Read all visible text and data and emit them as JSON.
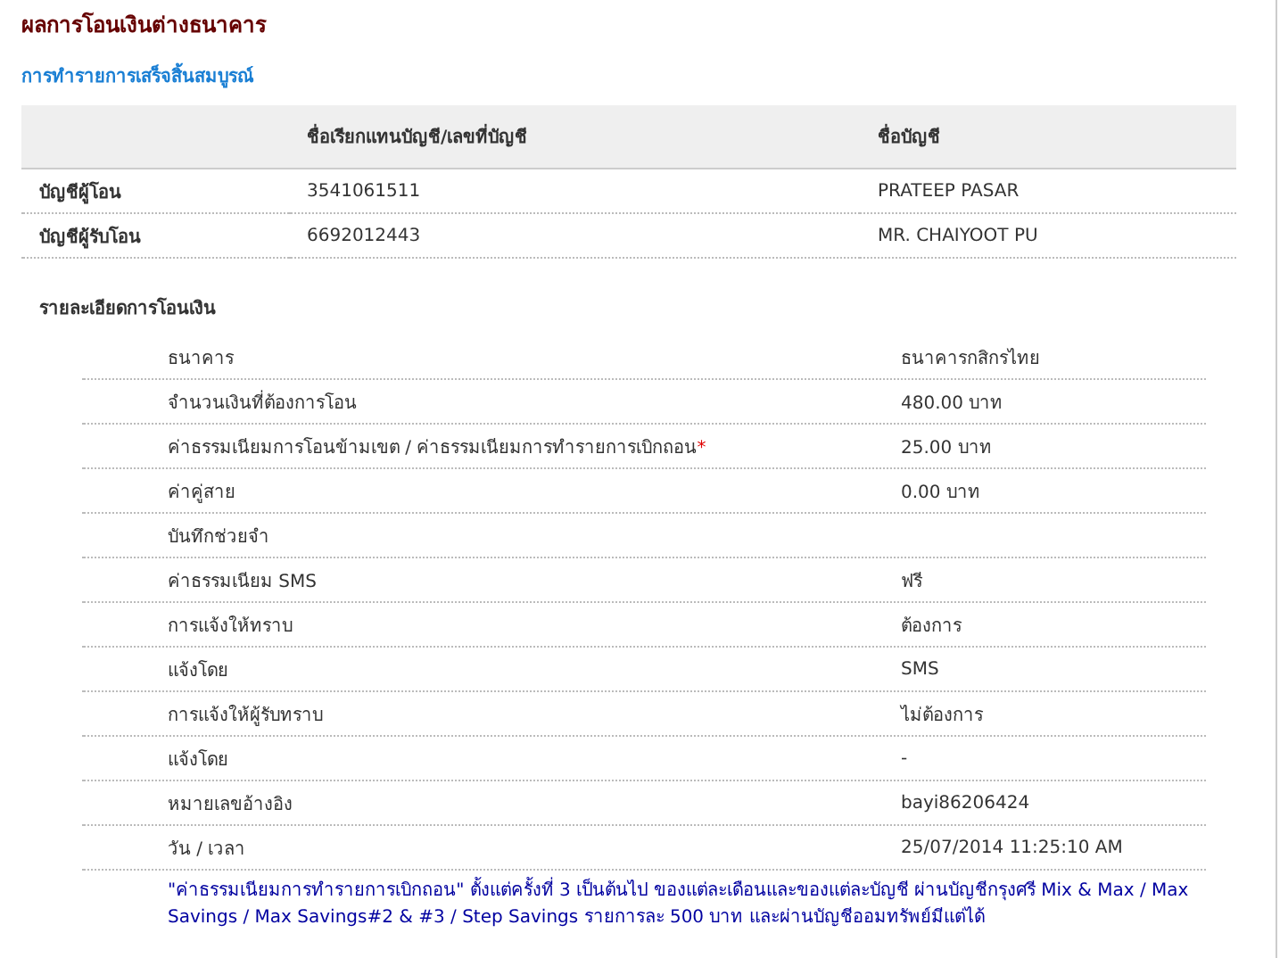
{
  "title": "ผลการโอนเงินต่างธนาคาร",
  "status": "การทำรายการเสร็จสิ้นสมบูรณ์",
  "accounts_table": {
    "columns": [
      "",
      "ชื่อเรียกแทนบัญชี/เลขที่บัญชี",
      "ชื่อบัญชี"
    ],
    "rows": [
      [
        "บัญชีผู้โอน",
        "3541061511",
        "PRATEEP PASAR"
      ],
      [
        "บัญชีผู้รับโอน",
        "6692012443",
        "MR. CHAIYOOT PU"
      ]
    ]
  },
  "details": {
    "heading": "รายละเอียดการโอนเงิน",
    "rows": [
      {
        "label": "ธนาคาร",
        "value": "ธนาคารกสิกรไทย"
      },
      {
        "label": "จำนวนเงินที่ต้องการโอน",
        "value": "480.00 บาท"
      },
      {
        "label": "ค่าธรรมเนียมการโอนข้ามเขต / ค่าธรรมเนียมการทำรายการเบิกถอน",
        "mark": "*",
        "value": "25.00 บาท"
      },
      {
        "label": "ค่าคู่สาย",
        "value": "0.00 บาท"
      },
      {
        "label": "บันทึกช่วยจำ"
      },
      {
        "label": "ค่าธรรมเนียม SMS",
        "value": "ฟรี"
      },
      {
        "label": "การแจ้งให้ทราบ",
        "value": "ต้องการ"
      },
      {
        "label": "แจ้งโดย",
        "value": "SMS"
      },
      {
        "label": "การแจ้งให้ผู้รับทราบ",
        "value": "ไม่ต้องการ"
      },
      {
        "label": "แจ้งโดย",
        "value": "-"
      },
      {
        "label": "หมายเลขอ้างอิง",
        "value": "bayi86206424"
      },
      {
        "label": "วัน / เวลา",
        "value": "25/07/2014 11:25:10 AM"
      }
    ]
  },
  "note": "\"ค่าธรรมเนียมการทำรายการเบิกถอน\" ตั้งแต่ครั้งที่ 3 เป็นต้นไป ของแต่ละเดือนและของแต่ละบัญชี ผ่านบัญชีกรุงศรี Mix & Max / Max Savings / Max Savings#2 & #3 / Step Savings รายการละ 500 บาท และผ่านบัญชีออมทรัพย์มีแต่ได้"
}
